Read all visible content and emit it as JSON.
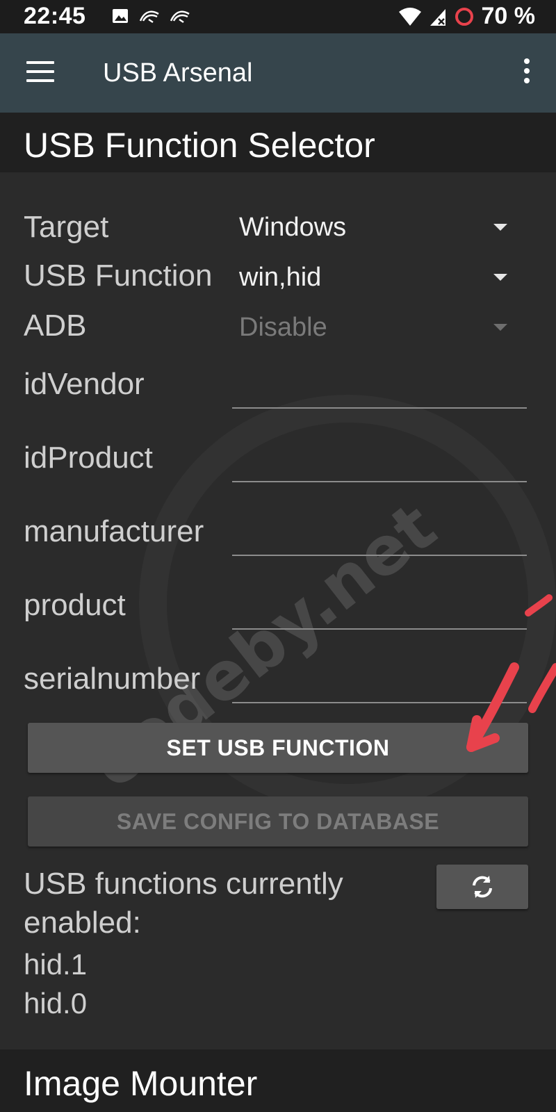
{
  "status_bar": {
    "time": "22:45",
    "left_icons": [
      "image-icon",
      "kali-dragon-icon",
      "kali-dragon-icon"
    ],
    "right_icons": [
      "wifi-icon",
      "no-signal-icon",
      "battery-saver-ring-icon"
    ],
    "battery": "70 %"
  },
  "app_bar": {
    "title": "USB Arsenal",
    "menu_icon": "hamburger-menu-icon",
    "overflow_icon": "more-vert-icon"
  },
  "usb_function_selector": {
    "header": "USB Function Selector",
    "target": {
      "label": "Target",
      "value": "Windows"
    },
    "usb_function": {
      "label": "USB Function",
      "value": "win,hid"
    },
    "adb": {
      "label": "ADB",
      "value": "Disable",
      "disabled": true
    },
    "fields": [
      {
        "label": "idVendor",
        "value": ""
      },
      {
        "label": "idProduct",
        "value": ""
      },
      {
        "label": "manufacturer",
        "value": ""
      },
      {
        "label": "product",
        "value": ""
      },
      {
        "label": "serialnumber",
        "value": ""
      }
    ],
    "set_button": "SET USB FUNCTION",
    "save_button": "SAVE CONFIG TO DATABASE",
    "enabled_label": "USB functions currently enabled:",
    "enabled_functions": [
      "hid.1",
      "hid.0"
    ],
    "refresh_icon": "refresh-icon"
  },
  "image_mounter": {
    "header": "Image Mounter"
  },
  "watermark": "codeby.net",
  "colors": {
    "app_bar": "#36454c",
    "annotation": "#e8424c"
  }
}
